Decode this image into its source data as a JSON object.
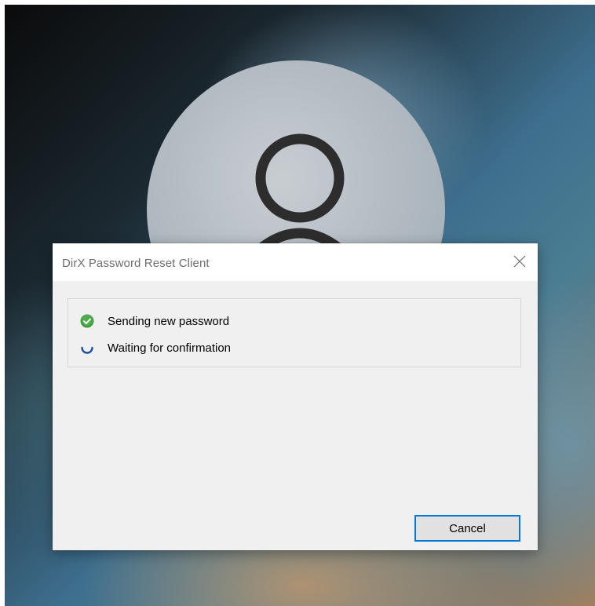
{
  "dialog": {
    "title": "DirX Password Reset Client",
    "close_icon": "close-icon",
    "steps": [
      {
        "icon": "check-circle-icon",
        "label": "Sending new password",
        "status": "done",
        "color": "#43a047"
      },
      {
        "icon": "spinner-icon",
        "label": "Waiting for confirmation",
        "status": "in-progress",
        "color": "#1e4f9c"
      }
    ],
    "cancel_label": "Cancel"
  },
  "background": {
    "avatar_icon": "user-avatar-icon"
  },
  "colors": {
    "accent": "#0078d7",
    "dialog_bg": "#f0f0f0",
    "titlebar_bg": "#ffffff"
  }
}
